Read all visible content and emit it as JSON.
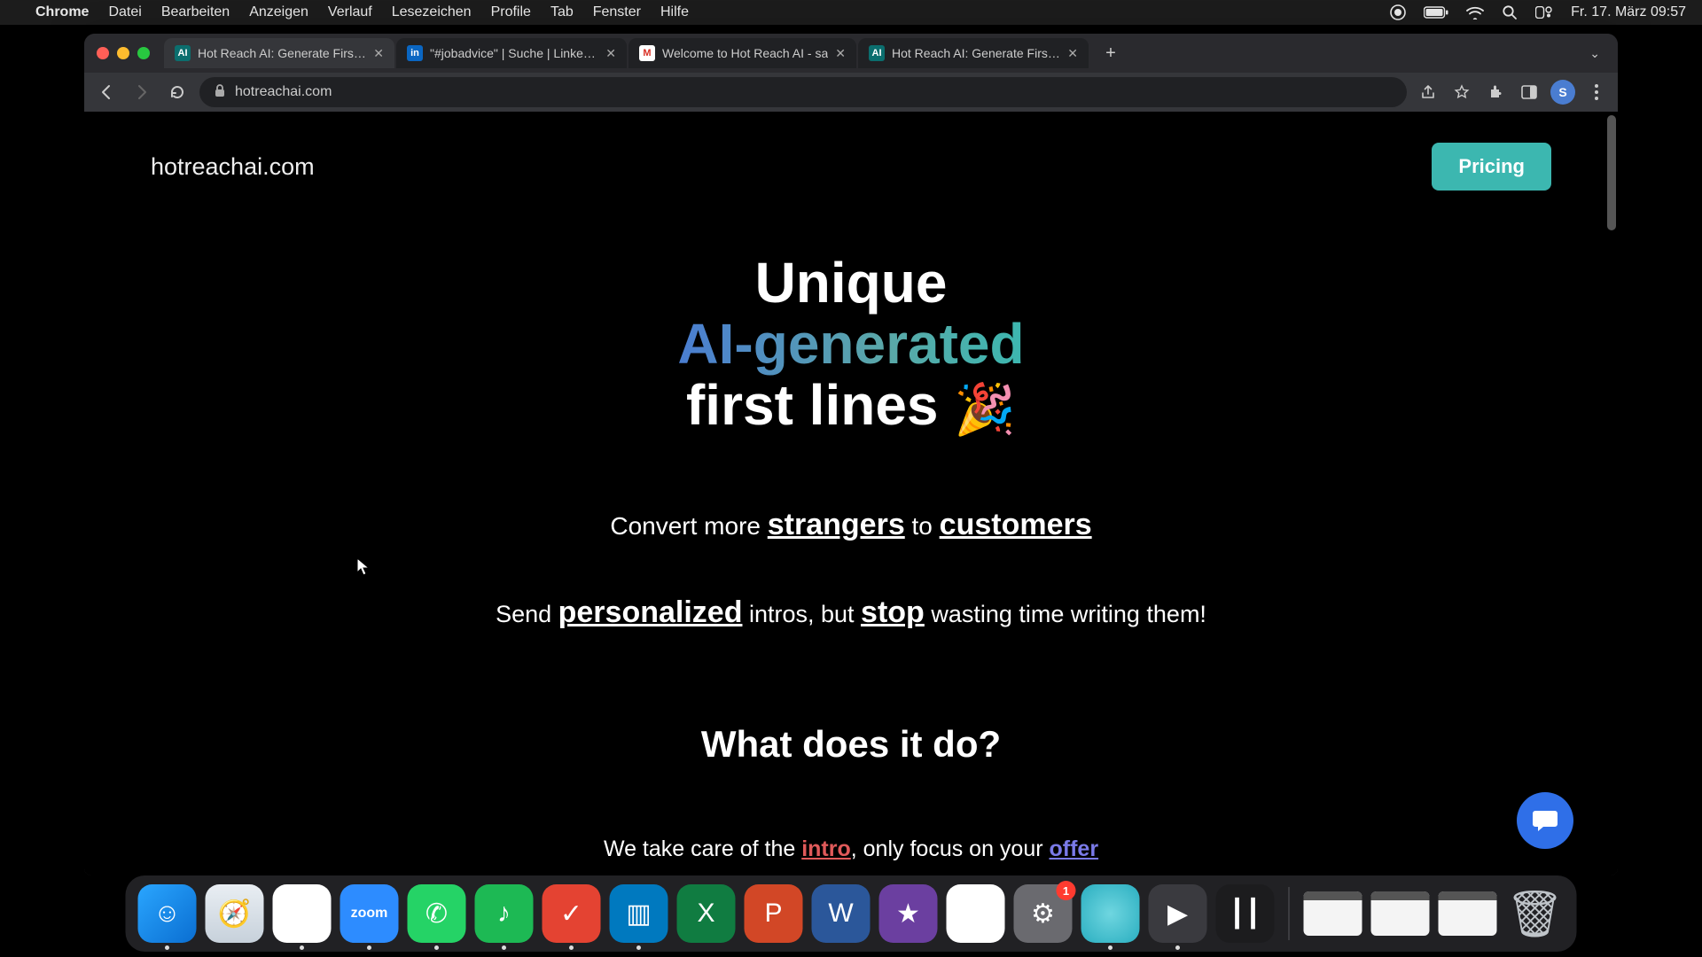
{
  "menubar": {
    "app": "Chrome",
    "items": [
      "Datei",
      "Bearbeiten",
      "Anzeigen",
      "Verlauf",
      "Lesezeichen",
      "Profile",
      "Tab",
      "Fenster",
      "Hilfe"
    ],
    "datetime": "Fr. 17. März  09:57"
  },
  "browser": {
    "tabs": [
      {
        "title": "Hot Reach AI: Generate First L",
        "favicon_label": "AI",
        "favicon_bg": "#0b6e6e",
        "active": true
      },
      {
        "title": "\"#jobadvice\" | Suche | LinkedIn",
        "favicon_label": "in",
        "favicon_bg": "#0a66c2",
        "active": false
      },
      {
        "title": "Welcome to Hot Reach AI - sa",
        "favicon_label": "M",
        "favicon_bg": "#ffffff",
        "active": false
      },
      {
        "title": "Hot Reach AI: Generate First L",
        "favicon_label": "AI",
        "favicon_bg": "#0b6e6e",
        "active": false
      }
    ],
    "url": "hotreachai.com",
    "profile_initial": "S"
  },
  "page": {
    "brand": "hotreachai.com",
    "pricing_label": "Pricing",
    "hero_line1": "Unique",
    "hero_line2": "AI-generated",
    "hero_line3_a": "first lines ",
    "hero_emoji": "🎉",
    "sub1_a": "Convert more ",
    "sub1_b": "strangers",
    "sub1_c": " to ",
    "sub1_d": "customers",
    "sub2_a": "Send ",
    "sub2_b": "personalized",
    "sub2_c": " intros, but ",
    "sub2_d": "stop",
    "sub2_e": " wasting time writing them!",
    "section_heading": "What does it do?",
    "section_p_a": "We take care of the ",
    "section_p_intro": "intro",
    "section_p_b": ", only focus on your ",
    "section_p_offer": "offer"
  },
  "dock": {
    "items": [
      {
        "name": "finder",
        "bg": "linear-gradient(135deg,#2aa6ff,#0a6ed1)",
        "glyph": "☺",
        "running": true
      },
      {
        "name": "safari",
        "bg": "linear-gradient(180deg,#e9eef3,#c7d1db)",
        "glyph": "🧭",
        "running": false
      },
      {
        "name": "chrome",
        "bg": "#ffffff",
        "glyph": "◉",
        "running": true
      },
      {
        "name": "zoom",
        "bg": "#2d8cff",
        "glyph": "zoom",
        "running": true,
        "text": true
      },
      {
        "name": "whatsapp",
        "bg": "#25d366",
        "glyph": "✆",
        "running": true
      },
      {
        "name": "spotify",
        "bg": "#1db954",
        "glyph": "♪",
        "running": true
      },
      {
        "name": "todoist",
        "bg": "#e44332",
        "glyph": "✓",
        "running": true
      },
      {
        "name": "trello",
        "bg": "#0079bf",
        "glyph": "▥",
        "running": true
      },
      {
        "name": "excel",
        "bg": "#107c41",
        "glyph": "X",
        "running": false
      },
      {
        "name": "powerpoint",
        "bg": "#d24726",
        "glyph": "P",
        "running": false
      },
      {
        "name": "word",
        "bg": "#2b579a",
        "glyph": "W",
        "running": false
      },
      {
        "name": "imovie",
        "bg": "#6b3fa0",
        "glyph": "★",
        "running": false
      },
      {
        "name": "drive",
        "bg": "#ffffff",
        "glyph": "▲",
        "running": false
      },
      {
        "name": "settings",
        "bg": "#6a6a6f",
        "glyph": "⚙",
        "running": false,
        "badge": "1"
      },
      {
        "name": "circle-app",
        "bg": "radial-gradient(circle,#6fd6e0,#2aaec0)",
        "glyph": "",
        "running": true
      },
      {
        "name": "quicktime",
        "bg": "#3a3a3f",
        "glyph": "▶",
        "running": true
      },
      {
        "name": "voice-memos",
        "bg": "#1c1c1e",
        "glyph": "┃┃",
        "running": false
      }
    ],
    "minis": 3,
    "trash": "🗑"
  }
}
